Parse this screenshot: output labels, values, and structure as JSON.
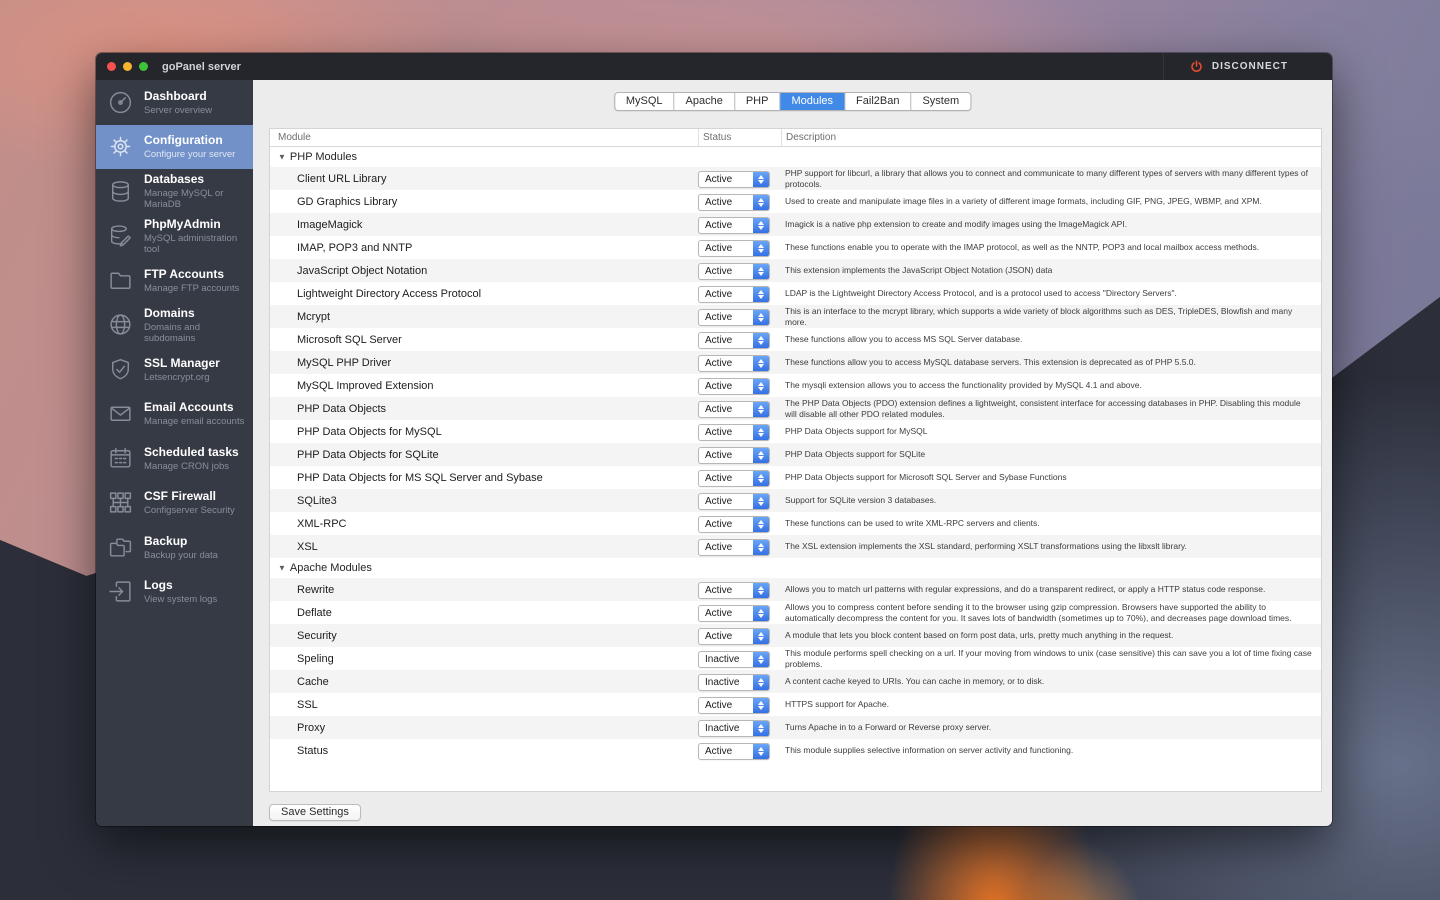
{
  "window": {
    "title": "goPanel server",
    "disconnect_label": "DISCONNECT"
  },
  "sidebar": {
    "items": [
      {
        "icon": "gauge-icon",
        "title": "Dashboard",
        "subtitle": "Server overview",
        "selected": false
      },
      {
        "icon": "gear-icon",
        "title": "Configuration",
        "subtitle": "Configure your server",
        "selected": true
      },
      {
        "icon": "database-icon",
        "title": "Databases",
        "subtitle": "Manage MySQL or MariaDB",
        "selected": false
      },
      {
        "icon": "database-edit-icon",
        "title": "PhpMyAdmin",
        "subtitle": "MySQL administration tool",
        "selected": false
      },
      {
        "icon": "folder-icon",
        "title": "FTP Accounts",
        "subtitle": "Manage FTP accounts",
        "selected": false
      },
      {
        "icon": "globe-icon",
        "title": "Domains",
        "subtitle": "Domains and subdomains",
        "selected": false
      },
      {
        "icon": "shield-check-icon",
        "title": "SSL Manager",
        "subtitle": "Letsencrypt.org",
        "selected": false
      },
      {
        "icon": "envelope-icon",
        "title": "Email Accounts",
        "subtitle": "Manage email accounts",
        "selected": false
      },
      {
        "icon": "calendar-icon",
        "title": "Scheduled tasks",
        "subtitle": "Manage CRON jobs",
        "selected": false
      },
      {
        "icon": "network-icon",
        "title": "CSF Firewall",
        "subtitle": "Configserver Security",
        "selected": false
      },
      {
        "icon": "backup-icon",
        "title": "Backup",
        "subtitle": "Backup your data",
        "selected": false
      },
      {
        "icon": "logs-icon",
        "title": "Logs",
        "subtitle": "View system logs",
        "selected": false
      }
    ]
  },
  "tabs": {
    "items": [
      "MySQL",
      "Apache",
      "PHP",
      "Modules",
      "Fail2Ban",
      "System"
    ],
    "selected": "Modules"
  },
  "table": {
    "columns": [
      "Module",
      "Status",
      "Description"
    ],
    "status_options_visible": [
      "Active",
      "Inactive"
    ],
    "sections": [
      {
        "title": "PHP Modules",
        "rows": [
          {
            "module": "Client URL Library",
            "status": "Active",
            "description": "PHP support for libcurl, a library that allows you to connect and communicate to many different types of servers with many different types of protocols."
          },
          {
            "module": "GD Graphics Library",
            "status": "Active",
            "description": "Used to create and manipulate image files in a variety of different image formats, including GIF, PNG, JPEG, WBMP, and XPM."
          },
          {
            "module": "ImageMagick",
            "status": "Active",
            "description": "Imagick is a native php extension to create and modify images using the ImageMagick API."
          },
          {
            "module": "IMAP, POP3 and NNTP",
            "status": "Active",
            "description": "These functions enable you to operate with the IMAP protocol, as well as the NNTP, POP3 and local mailbox access methods."
          },
          {
            "module": "JavaScript Object Notation",
            "status": "Active",
            "description": "This extension implements the JavaScript Object Notation (JSON) data"
          },
          {
            "module": "Lightweight Directory Access Protocol",
            "status": "Active",
            "description": "LDAP is the Lightweight Directory Access Protocol, and is a protocol used to access \"Directory Servers\"."
          },
          {
            "module": "Mcrypt",
            "status": "Active",
            "description": "This is an interface to the mcrypt library, which supports a wide variety of block algorithms such as DES, TripleDES, Blowfish and many more."
          },
          {
            "module": "Microsoft SQL Server",
            "status": "Active",
            "description": "These functions allow you to access MS SQL Server database."
          },
          {
            "module": "MySQL PHP Driver",
            "status": "Active",
            "description": "These functions allow you to access MySQL database servers. This extension is deprecated as of PHP 5.5.0."
          },
          {
            "module": "MySQL Improved Extension",
            "status": "Active",
            "description": "The mysqli extension allows you to access the functionality provided by MySQL 4.1 and above."
          },
          {
            "module": "PHP Data Objects",
            "status": "Active",
            "description": "The PHP Data Objects (PDO) extension defines a lightweight, consistent interface for accessing databases in PHP. Disabling this module will disable all other PDO related modules."
          },
          {
            "module": "PHP Data Objects for MySQL",
            "status": "Active",
            "description": "PHP Data Objects support for MySQL"
          },
          {
            "module": "PHP Data Objects for SQLite",
            "status": "Active",
            "description": "PHP Data Objects support for SQLite"
          },
          {
            "module": "PHP Data Objects for MS SQL Server and Sybase",
            "status": "Active",
            "description": "PHP Data Objects support for Microsoft SQL Server and Sybase Functions"
          },
          {
            "module": "SQLite3",
            "status": "Active",
            "description": "Support for SQLite version 3 databases."
          },
          {
            "module": "XML-RPC",
            "status": "Active",
            "description": "These functions can be used to write XML-RPC servers and clients."
          },
          {
            "module": "XSL",
            "status": "Active",
            "description": "The XSL extension implements the XSL standard, performing XSLT transformations using the libxslt library."
          }
        ]
      },
      {
        "title": "Apache Modules",
        "rows": [
          {
            "module": "Rewrite",
            "status": "Active",
            "description": "Allows you to match url patterns with regular expressions, and do a transparent redirect, or apply a HTTP status code response."
          },
          {
            "module": "Deflate",
            "status": "Active",
            "description": "Allows you to compress content before sending it to the browser using gzip compression. Browsers have supported the ability to automatically decompress the content for you. It saves lots of bandwidth (sometimes up to 70%), and decreases page download times."
          },
          {
            "module": "Security",
            "status": "Active",
            "description": "A module that lets you block content based on form post data, urls, pretty much anything in the request."
          },
          {
            "module": "Speling",
            "status": "Inactive",
            "description": "This module performs spell checking on a url. If your moving from windows to unix (case sensitive) this can save you a lot of time fixing case problems."
          },
          {
            "module": "Cache",
            "status": "Inactive",
            "description": "A content cache keyed to URIs. You can cache in memory, or to disk."
          },
          {
            "module": "SSL",
            "status": "Active",
            "description": "HTTPS support for Apache."
          },
          {
            "module": "Proxy",
            "status": "Inactive",
            "description": "Turns Apache in to a Forward or Reverse proxy server."
          },
          {
            "module": "Status",
            "status": "Active",
            "description": "This module supplies selective information on server activity and functioning."
          }
        ]
      }
    ]
  },
  "footer": {
    "save_label": "Save Settings"
  },
  "colors": {
    "accent_blue": "#4189e7",
    "sidebar_selected_blue": "#7291c9",
    "popup_cap_blue": "#3d7de8",
    "disconnect_orange": "#e2492f",
    "sidebar_bg": "#363a45",
    "titlebar_bg": "#24262c",
    "content_bg": "#ececec"
  }
}
